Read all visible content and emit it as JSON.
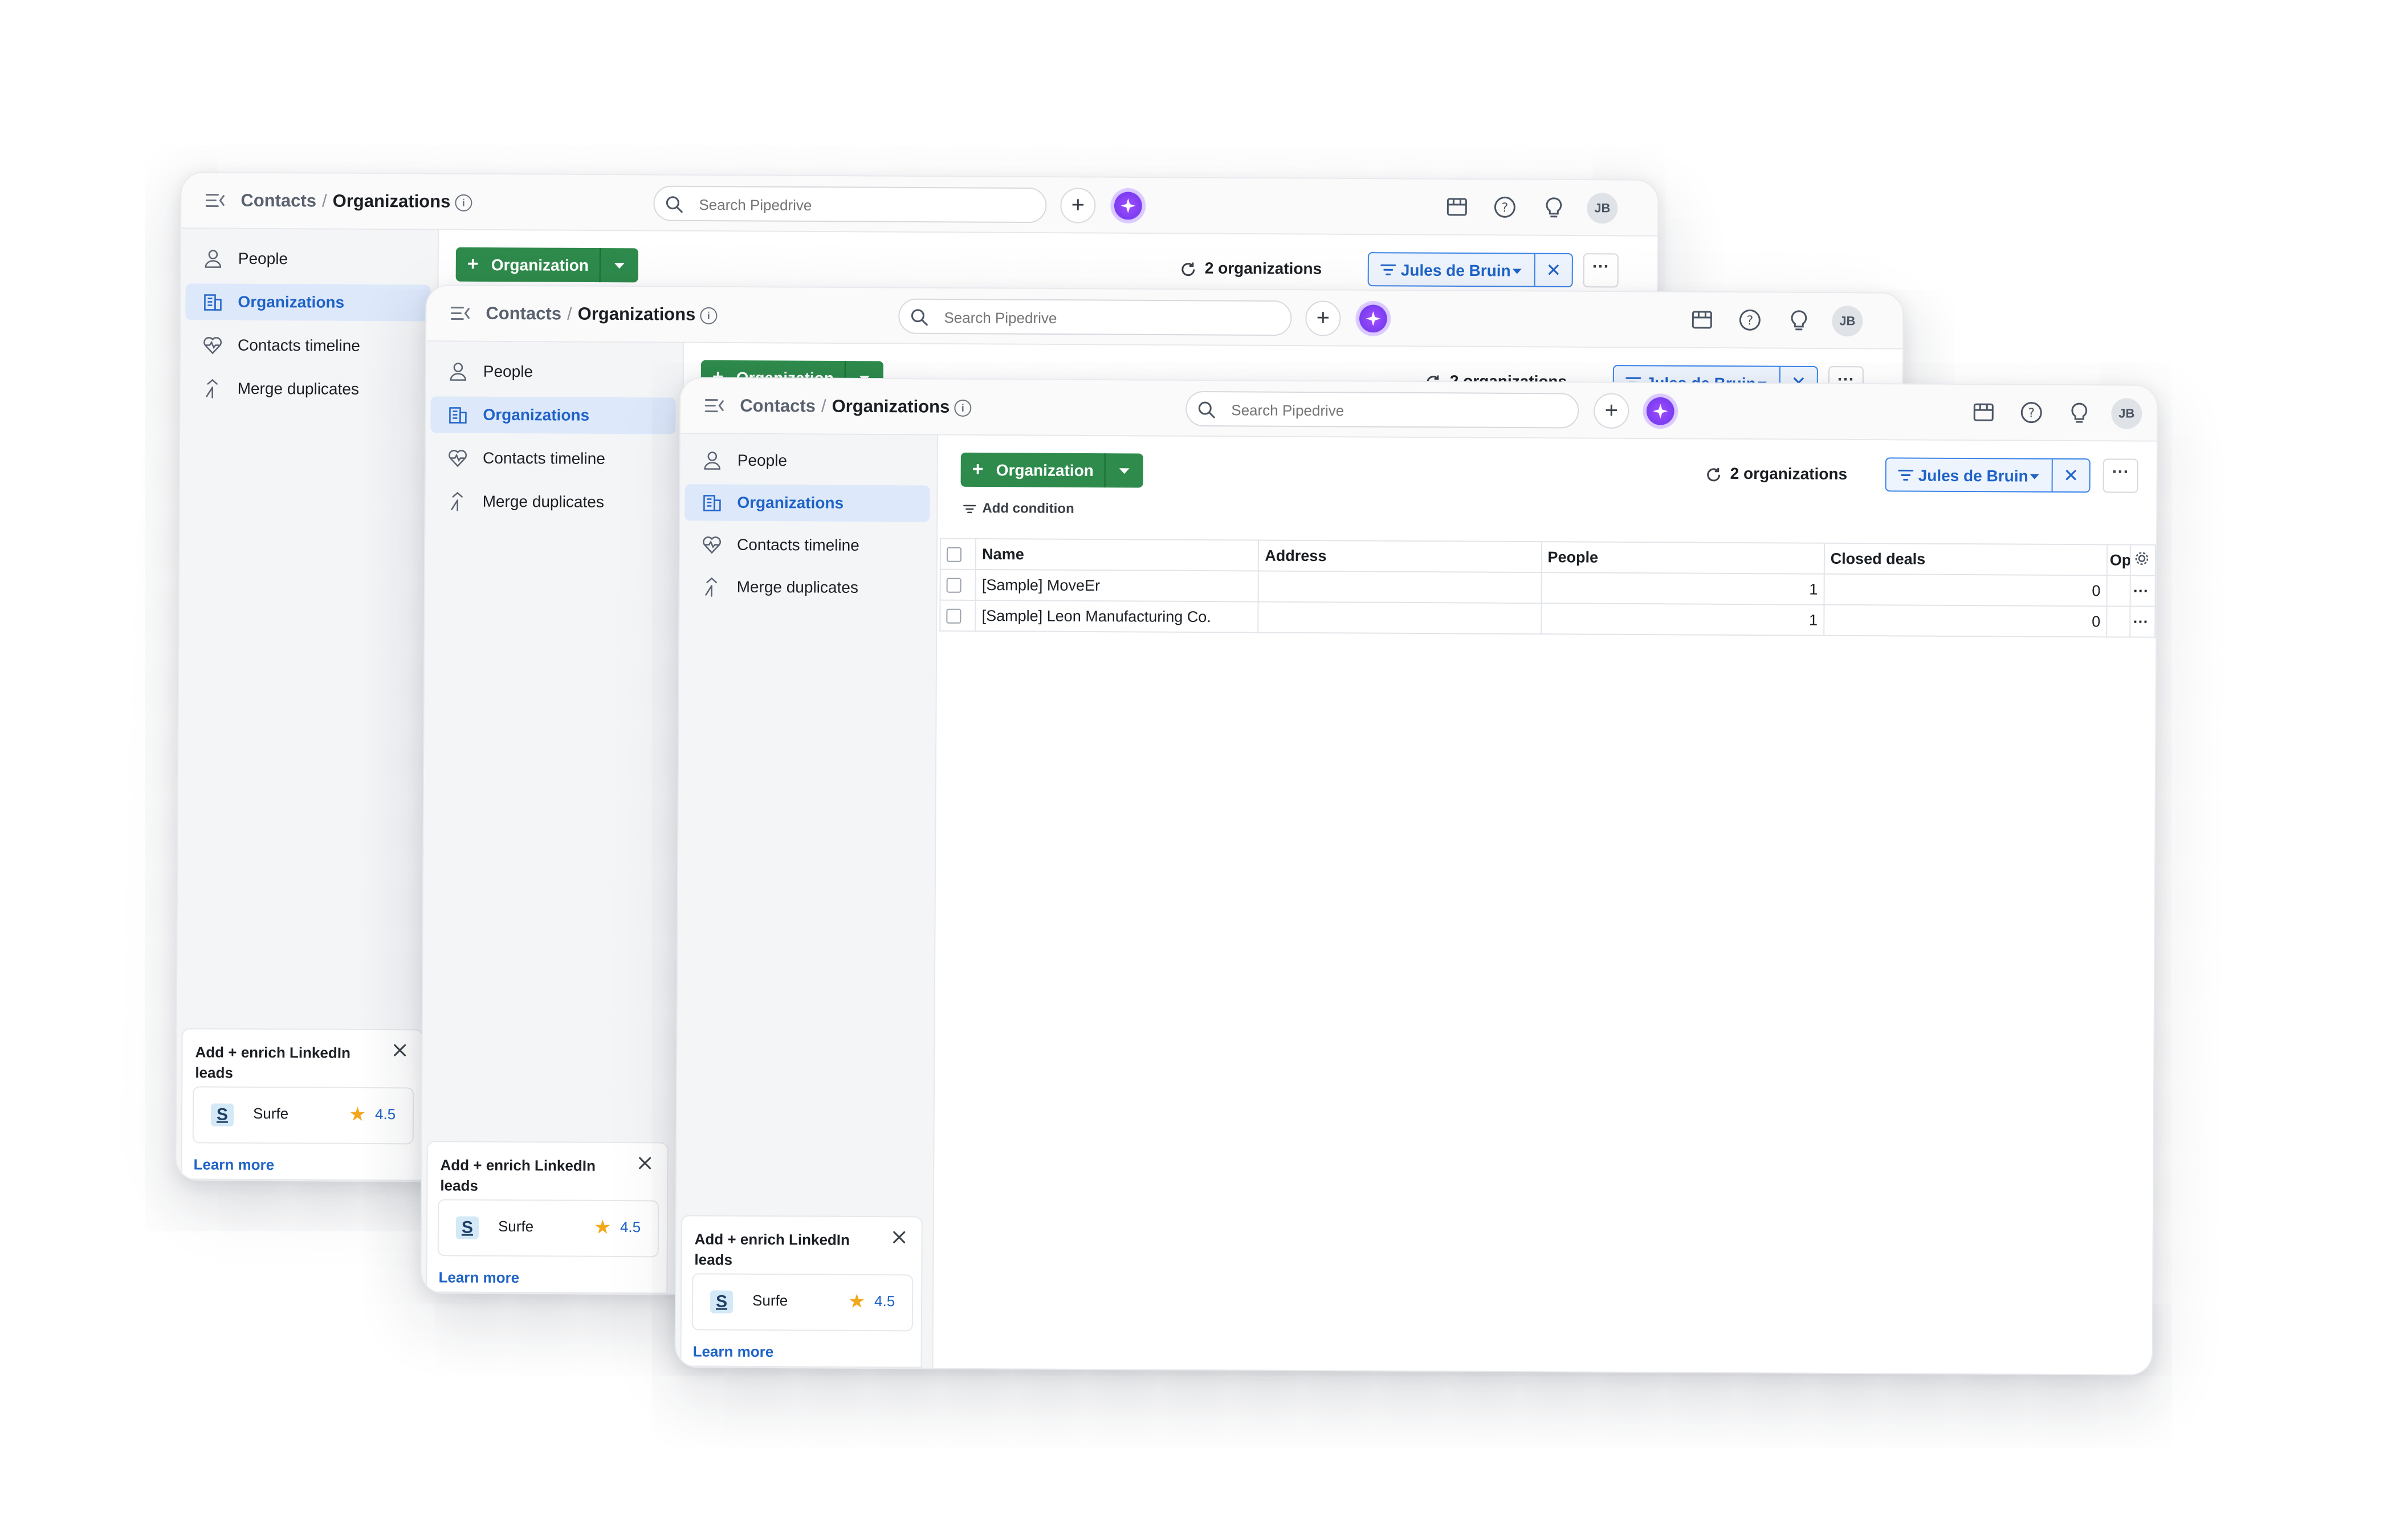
{
  "app": {
    "breadcrumb": {
      "parent": "Contacts",
      "separator": "/",
      "current": "Organizations",
      "info_icon": "i"
    },
    "search": {
      "placeholder": "Search Pipedrive"
    },
    "add_button": "+",
    "avatar_initials": "JB"
  },
  "sidebar": {
    "items": [
      {
        "label": "People",
        "icon": "person-icon"
      },
      {
        "label": "Organizations",
        "icon": "building-icon",
        "active": true
      },
      {
        "label": "Contacts timeline",
        "icon": "heart-pulse-icon"
      },
      {
        "label": "Merge duplicates",
        "icon": "merge-icon"
      }
    ]
  },
  "promo": {
    "title": "Add + enrich LinkedIn leads",
    "app_logo": "S",
    "app_name": "Surfe",
    "rating_star": "★",
    "rating": "4.5",
    "learn_more": "Learn more"
  },
  "toolbar": {
    "add_org_plus": "+",
    "add_org_label": "Organization",
    "count_label": "2 organizations",
    "filter_label": "Jules de Bruin",
    "filter_clear": "✕",
    "more": "···",
    "add_condition": "Add condition"
  },
  "table": {
    "columns": [
      "Name",
      "Address",
      "People",
      "Closed deals",
      "Op"
    ],
    "rows": [
      {
        "name": "[Sample] MoveEr",
        "address": "",
        "people": "1",
        "closed_deals": "0",
        "actions": "···"
      },
      {
        "name": "[Sample] Leon Manufacturing Co.",
        "address": "",
        "people": "1",
        "closed_deals": "0",
        "actions": "···"
      }
    ]
  },
  "colors": {
    "accent_green": "#2e8b4c",
    "accent_blue": "#1f63c7",
    "active_bg": "#dde8fb"
  }
}
